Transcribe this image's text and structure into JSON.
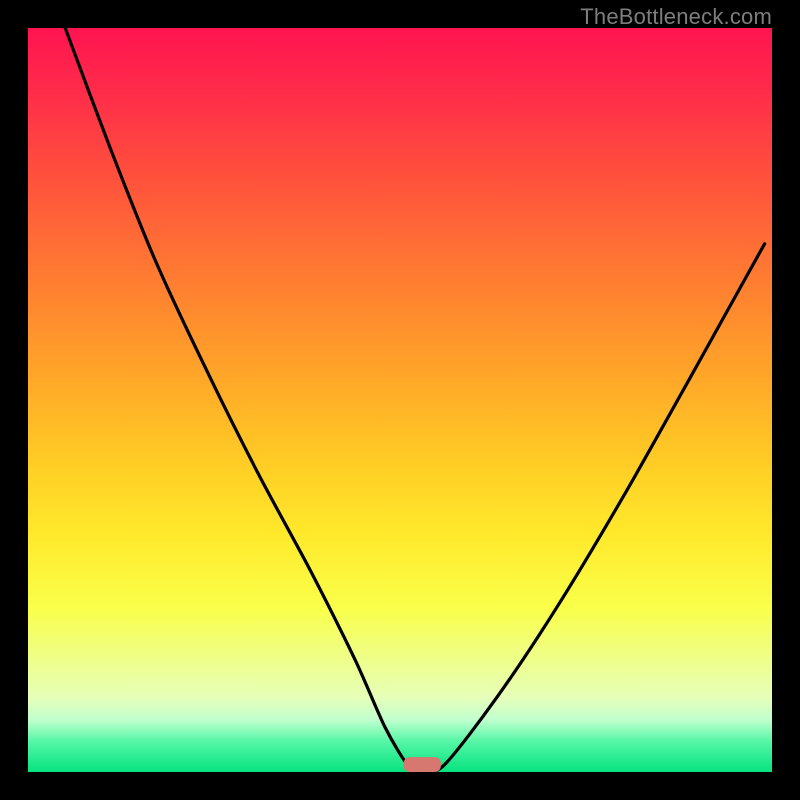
{
  "watermark": {
    "text": "TheBottleneck.com"
  },
  "chart_data": {
    "type": "line",
    "title": "",
    "xlabel": "",
    "ylabel": "",
    "xlim": [
      0,
      100
    ],
    "ylim": [
      0,
      100
    ],
    "grid": false,
    "legend": "none",
    "series": [
      {
        "name": "bottleneck-curve",
        "x": [
          5,
          11,
          17,
          24,
          31,
          38,
          44,
          48,
          51,
          53,
          56,
          63,
          71,
          80,
          89,
          99
        ],
        "y": [
          100,
          84,
          69,
          54,
          40,
          27,
          15,
          6,
          1,
          0,
          1,
          10,
          22,
          37,
          53,
          71
        ]
      }
    ],
    "marker": {
      "x": 53,
      "y": 0,
      "w": 5,
      "h": 2
    },
    "background_gradient": {
      "stops": [
        {
          "pos": 0,
          "color": "#ff1450"
        },
        {
          "pos": 18,
          "color": "#ff4a3e"
        },
        {
          "pos": 38,
          "color": "#ff8a2e"
        },
        {
          "pos": 58,
          "color": "#ffcb25"
        },
        {
          "pos": 78,
          "color": "#f9ff4a"
        },
        {
          "pos": 93,
          "color": "#c0ffce"
        },
        {
          "pos": 100,
          "color": "#07e27f"
        }
      ]
    }
  }
}
